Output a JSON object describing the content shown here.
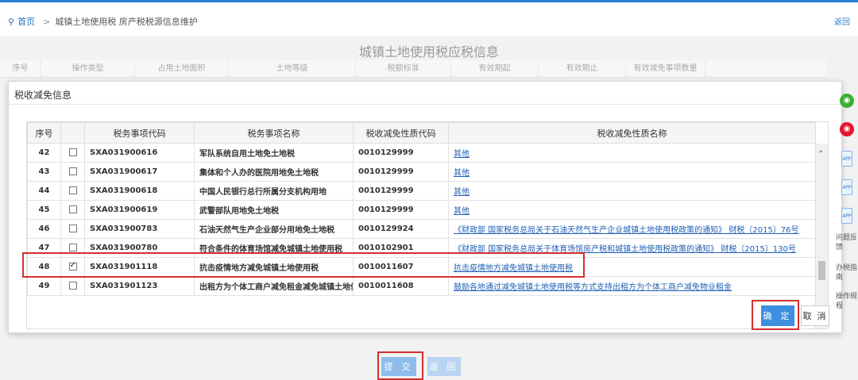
{
  "breadcrumb": {
    "home": "首页",
    "separator": ">",
    "path": "城镇土地使用税 房产税税源信息维护"
  },
  "back_link": "返回",
  "page_title": "城镇土地使用税应税信息",
  "bg_header": [
    "序号",
    "操作类型",
    "占用土地面积",
    "土地等级",
    "税额标准",
    "有效期起",
    "有效期止",
    "有效减免事项数量"
  ],
  "modal": {
    "title": "税收减免信息",
    "columns": [
      "序号",
      "",
      "税务事项代码",
      "税务事项名称",
      "税收减免性质代码",
      "税收减免性质名称"
    ],
    "rows": [
      {
        "no": "42",
        "checked": false,
        "code": "SXA031900616",
        "name": "军队系统自用土地免土地税",
        "nature_code": "0010129999",
        "nature_name": "其他"
      },
      {
        "no": "43",
        "checked": false,
        "code": "SXA031900617",
        "name": "集体和个人办的医院用地免土地税",
        "nature_code": "0010129999",
        "nature_name": "其他"
      },
      {
        "no": "44",
        "checked": false,
        "code": "SXA031900618",
        "name": "中国人民银行总行所属分支机构用地",
        "nature_code": "0010129999",
        "nature_name": "其他"
      },
      {
        "no": "45",
        "checked": false,
        "code": "SXA031900619",
        "name": "武警部队用地免土地税",
        "nature_code": "0010129999",
        "nature_name": "其他"
      },
      {
        "no": "46",
        "checked": false,
        "code": "SXA031900783",
        "name": "石油天然气生产企业部分用地免土地税",
        "nature_code": "0010129924",
        "nature_name": "《财政部 国家税务总局关于石油天然气生产企业城镇土地使用税政策的通知》 财税〔2015〕76号"
      },
      {
        "no": "47",
        "checked": false,
        "code": "SXA031900780",
        "name": "符合条件的体育场馆减免城镇土地使用税",
        "nature_code": "0010102901",
        "nature_name": "《财政部 国家税务总局关于体育场馆房产税和城镇土地使用税政策的通知》 财税〔2015〕130号"
      },
      {
        "no": "48",
        "checked": true,
        "code": "SXA031901118",
        "name": "抗击疫情地方减免城镇土地使用税",
        "nature_code": "0010011607",
        "nature_name": "抗击疫情地方减免城镇土地使用税"
      },
      {
        "no": "49",
        "checked": false,
        "code": "SXA031901123",
        "name": "出租方为个体工商户减免租金减免城镇土地使用税",
        "nature_code": "0010011608",
        "nature_name": "鼓励各地通过减免城镇土地使用税等方式支持出租方为个体工商户减免物业租金"
      }
    ],
    "ok_label": "确 定",
    "cancel_label": "取 消"
  },
  "sidebar": {
    "items": [
      {
        "icon": "wechat-icon",
        "color": "#3cb034"
      },
      {
        "icon": "weibo-icon",
        "color": "#e6162d"
      },
      {
        "icon": "app-icon"
      },
      {
        "icon": "app-icon"
      },
      {
        "icon": "app-icon"
      }
    ],
    "app_label": "APP",
    "texts": [
      "问题反馈",
      "办税指南",
      "操作规程"
    ]
  },
  "footer": {
    "submit_label": "提 交",
    "return_label": "返 回"
  },
  "colors": {
    "accent": "#2a7fd4",
    "highlight": "#d32f2f",
    "link": "#1f5fb4"
  }
}
